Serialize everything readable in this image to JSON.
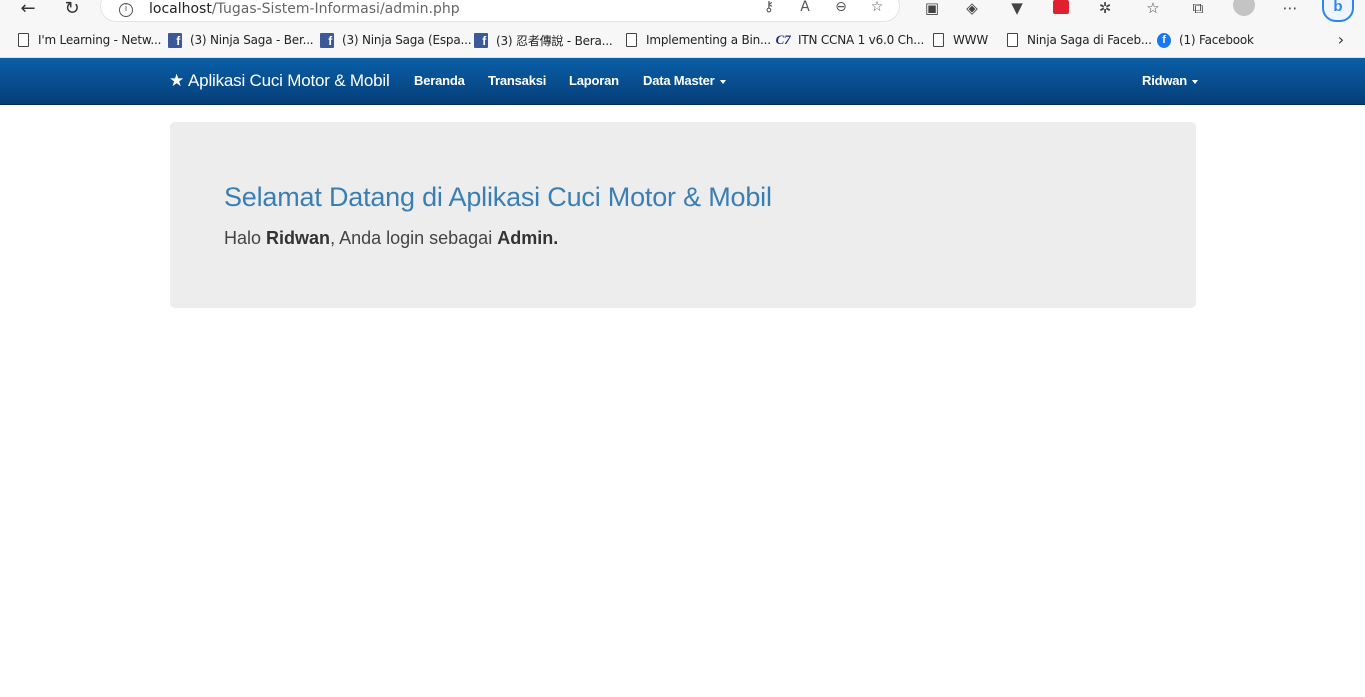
{
  "browser": {
    "address_host": "localhost",
    "address_path": "/Tugas-Sistem-Informasi/admin.php",
    "bookmarks": [
      {
        "icon": "page-icon",
        "label": "I'm Learning - Netw..."
      },
      {
        "icon": "facebook-icon",
        "label": "(3) Ninja Saga - Ber..."
      },
      {
        "icon": "facebook-icon",
        "label": "(3) Ninja Saga (Espa..."
      },
      {
        "icon": "facebook-icon",
        "label": "(3) 忍者傳說 - Bera..."
      },
      {
        "icon": "page-icon",
        "label": "Implementing a Bin..."
      },
      {
        "icon": "c7-icon",
        "label": "ITN CCNA 1 v6.0 Ch..."
      },
      {
        "icon": "page-icon",
        "label": "WWW"
      },
      {
        "icon": "page-icon",
        "label": "Ninja Saga di Faceb..."
      },
      {
        "icon": "facebook-round-icon",
        "label": "(1) Facebook"
      }
    ]
  },
  "navbar": {
    "brand": "Aplikasi Cuci Motor & Mobil",
    "items": [
      "Beranda",
      "Transaksi",
      "Laporan",
      "Data Master"
    ],
    "user": "Ridwan",
    "color_top": "#0a5fa8",
    "color_bottom": "#063e78"
  },
  "jumbotron": {
    "title": "Selamat Datang di Aplikasi Cuci Motor & Mobil",
    "greeting_prefix": "Halo",
    "user_name": "Ridwan",
    "greeting_middle": ", Anda login sebagai",
    "role": "Admin.",
    "title_color": "#3a7fb4",
    "background": "#ededed"
  }
}
